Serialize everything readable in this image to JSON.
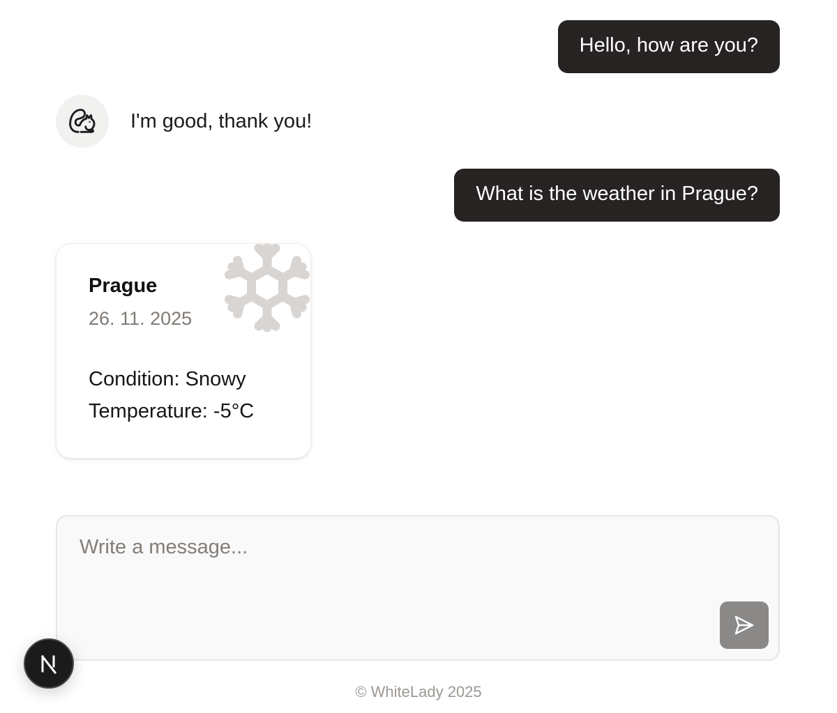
{
  "messages": [
    {
      "role": "user",
      "text": "Hello, how are you?"
    },
    {
      "role": "assistant",
      "text": "I'm good, thank you!",
      "avatar_icon": "squirrel-icon"
    },
    {
      "role": "user",
      "text": "What is the weather in Prague?"
    }
  ],
  "weather_card": {
    "city": "Prague",
    "date": "26. 11. 2025",
    "condition_line": "Condition: Snowy",
    "temperature_line": "Temperature: -5°C",
    "icon": "snowflake-icon",
    "icon_color": "#d8d5d3"
  },
  "composer": {
    "placeholder": "Write a message...",
    "value": "",
    "send_icon": "send-icon"
  },
  "footer": {
    "text": "© WhiteLady 2025"
  },
  "dev_badge": {
    "icon": "nextjs-icon"
  },
  "colors": {
    "user_bubble_bg": "#262322",
    "send_button_bg": "#8a8988"
  }
}
